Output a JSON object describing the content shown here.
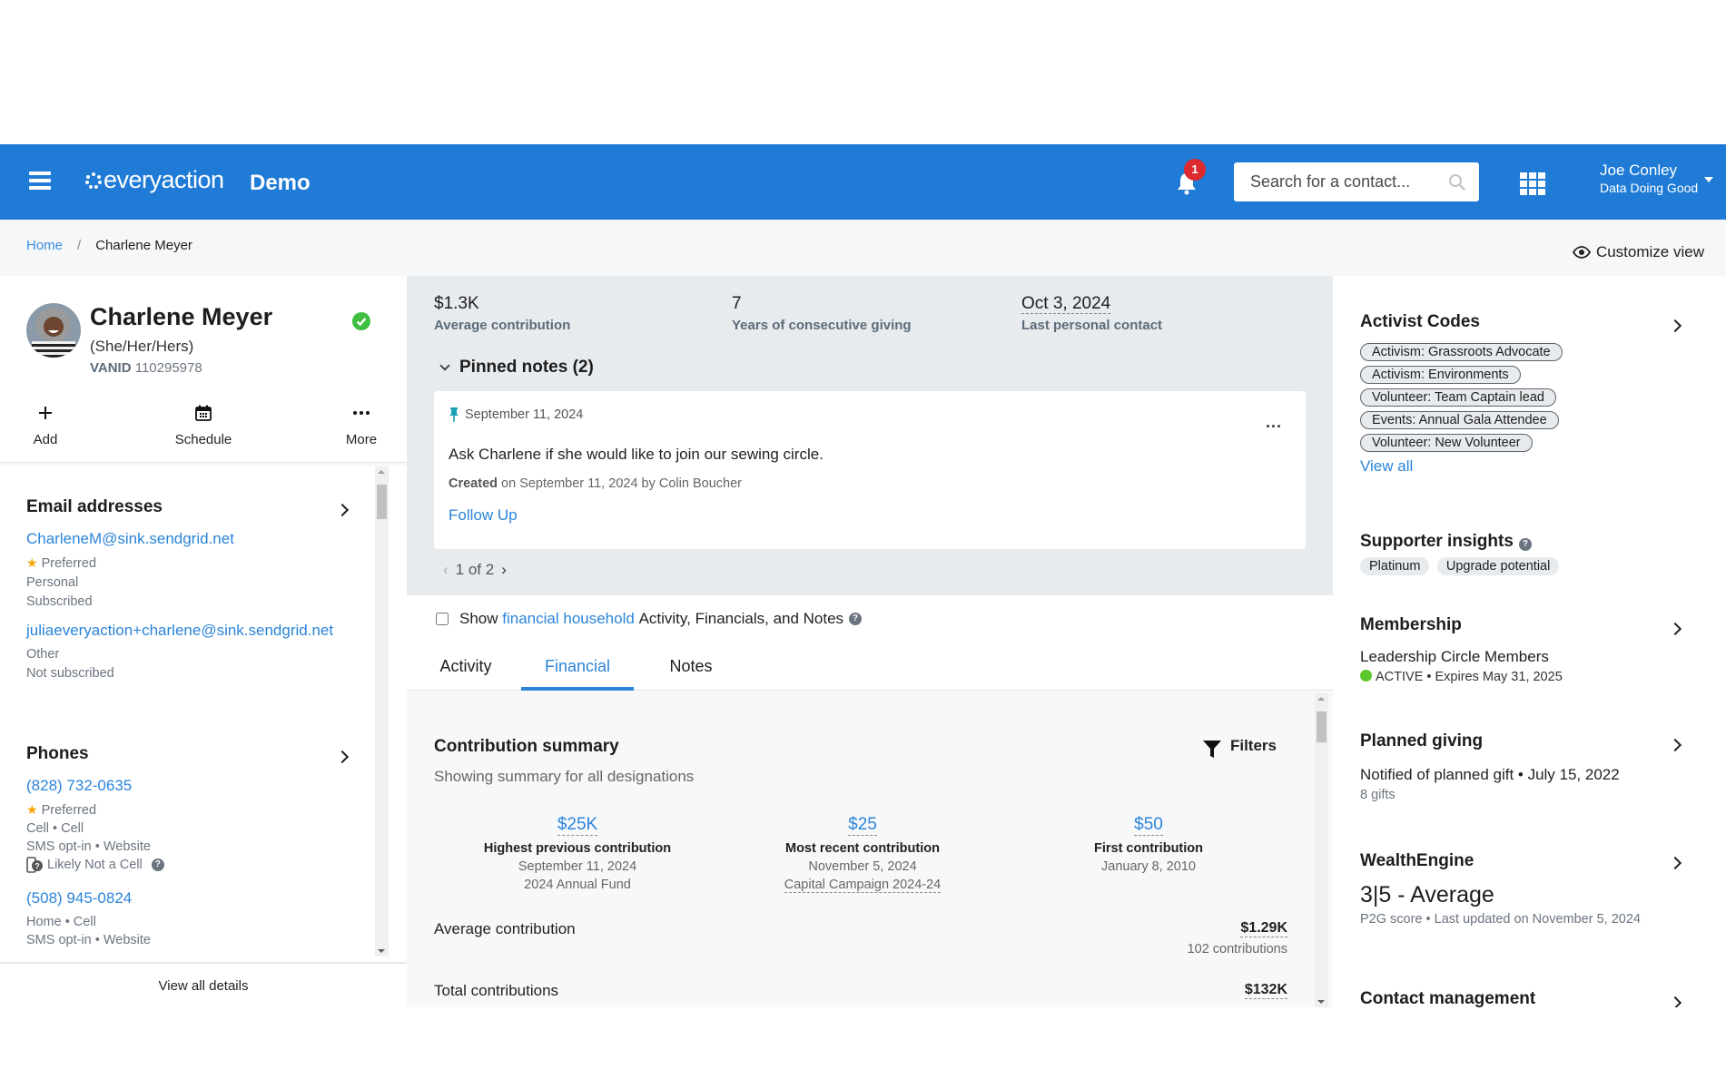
{
  "header": {
    "logo_text": "everyaction",
    "env_label": "Demo",
    "notification_count": "1",
    "search_placeholder": "Search for a contact...",
    "user_name": "Joe Conley",
    "user_org": "Data Doing Good",
    "brand_color": "#1f7bd6"
  },
  "breadcrumb": {
    "home": "Home",
    "separator": "/",
    "current": "Charlene Meyer",
    "customize_view": "Customize view"
  },
  "profile": {
    "name": "Charlene Meyer",
    "pronouns": "(She/Her/Hers)",
    "vanid_label": "VANID",
    "vanid": "110295978",
    "actions": [
      {
        "label": "Add",
        "icon": "plus-icon"
      },
      {
        "label": "Schedule",
        "icon": "calendar-icon"
      },
      {
        "label": "More",
        "icon": "ellipsis-icon"
      }
    ],
    "view_all_details": "View all details"
  },
  "emails": {
    "title": "Email addresses",
    "items": [
      {
        "address": "CharleneM@sink.sendgrid.net",
        "preferred": "Preferred",
        "type": "Personal",
        "status": "Subscribed"
      },
      {
        "address": "juliaeveryaction+charlene@sink.sendgrid.net",
        "type": "Other",
        "status": "Not subscribed"
      }
    ]
  },
  "phones": {
    "title": "Phones",
    "items": [
      {
        "number": "(828) 732-0635",
        "preferred": "Preferred",
        "type": "Cell • Cell",
        "sms": "SMS opt-in • Website",
        "flag": "Likely Not a Cell"
      },
      {
        "number": "(508) 945-0824",
        "type": "Home • Cell",
        "sms": "SMS opt-in • Website"
      }
    ]
  },
  "stats": [
    {
      "value": "$1.3K",
      "label": "Average contribution"
    },
    {
      "value": "7",
      "label": "Years of consecutive giving"
    },
    {
      "value": "Oct 3, 2024",
      "label": "Last personal contact"
    }
  ],
  "pinned_notes": {
    "title": "Pinned notes (2)",
    "note": {
      "date": "September 11, 2024",
      "body": "Ask Charlene if she would like to join our sewing circle.",
      "created_label": "Created",
      "created_rest": "on September 11, 2024 by Colin Boucher",
      "follow_up": "Follow Up",
      "more": "..."
    },
    "pager": "1 of 2"
  },
  "household": {
    "show": "Show",
    "link": "financial household",
    "rest": "Activity, Financials, and Notes",
    "checked": false
  },
  "tabs": [
    {
      "label": "Activity",
      "active": false
    },
    {
      "label": "Financial",
      "active": true
    },
    {
      "label": "Notes",
      "active": false
    }
  ],
  "contribution_summary": {
    "title": "Contribution summary",
    "subtitle": "Showing summary for all designations",
    "filters": "Filters",
    "kpis": [
      {
        "amount": "$25K",
        "label": "Highest previous contribution",
        "date": "September 11, 2024",
        "detail": "2024 Annual Fund"
      },
      {
        "amount": "$25",
        "label": "Most recent contribution",
        "date": "November 5, 2024",
        "detail": "Capital Campaign 2024-24"
      },
      {
        "amount": "$50",
        "label": "First contribution",
        "date": "January 8, 2010",
        "detail": ""
      }
    ],
    "average": {
      "label": "Average contribution",
      "value": "$1.29K",
      "sub": "102 contributions"
    },
    "total": {
      "label": "Total contributions",
      "value": "$132K"
    }
  },
  "right": {
    "activist_codes": {
      "title": "Activist Codes",
      "codes": [
        "Activism: Grassroots Advocate",
        "Activism: Environments",
        "Volunteer: Team Captain lead",
        "Events: Annual Gala Attendee",
        "Volunteer: New Volunteer"
      ],
      "view_all": "View all"
    },
    "supporter_insights": {
      "title": "Supporter insights",
      "tags": [
        "Platinum",
        "Upgrade potential"
      ]
    },
    "membership": {
      "title": "Membership",
      "name": "Leadership Circle Members",
      "status": "ACTIVE",
      "expires": "• Expires May 31, 2025",
      "status_color": "#5dc72b"
    },
    "planned_giving": {
      "title": "Planned giving",
      "line": "Notified of planned gift • July 15, 2022",
      "sub": "8 gifts"
    },
    "wealthengine": {
      "title": "WealthEngine",
      "score": "3|5 - Average",
      "sub": "P2G score • Last updated on November 5, 2024"
    },
    "contact_management": {
      "title": "Contact management"
    }
  }
}
